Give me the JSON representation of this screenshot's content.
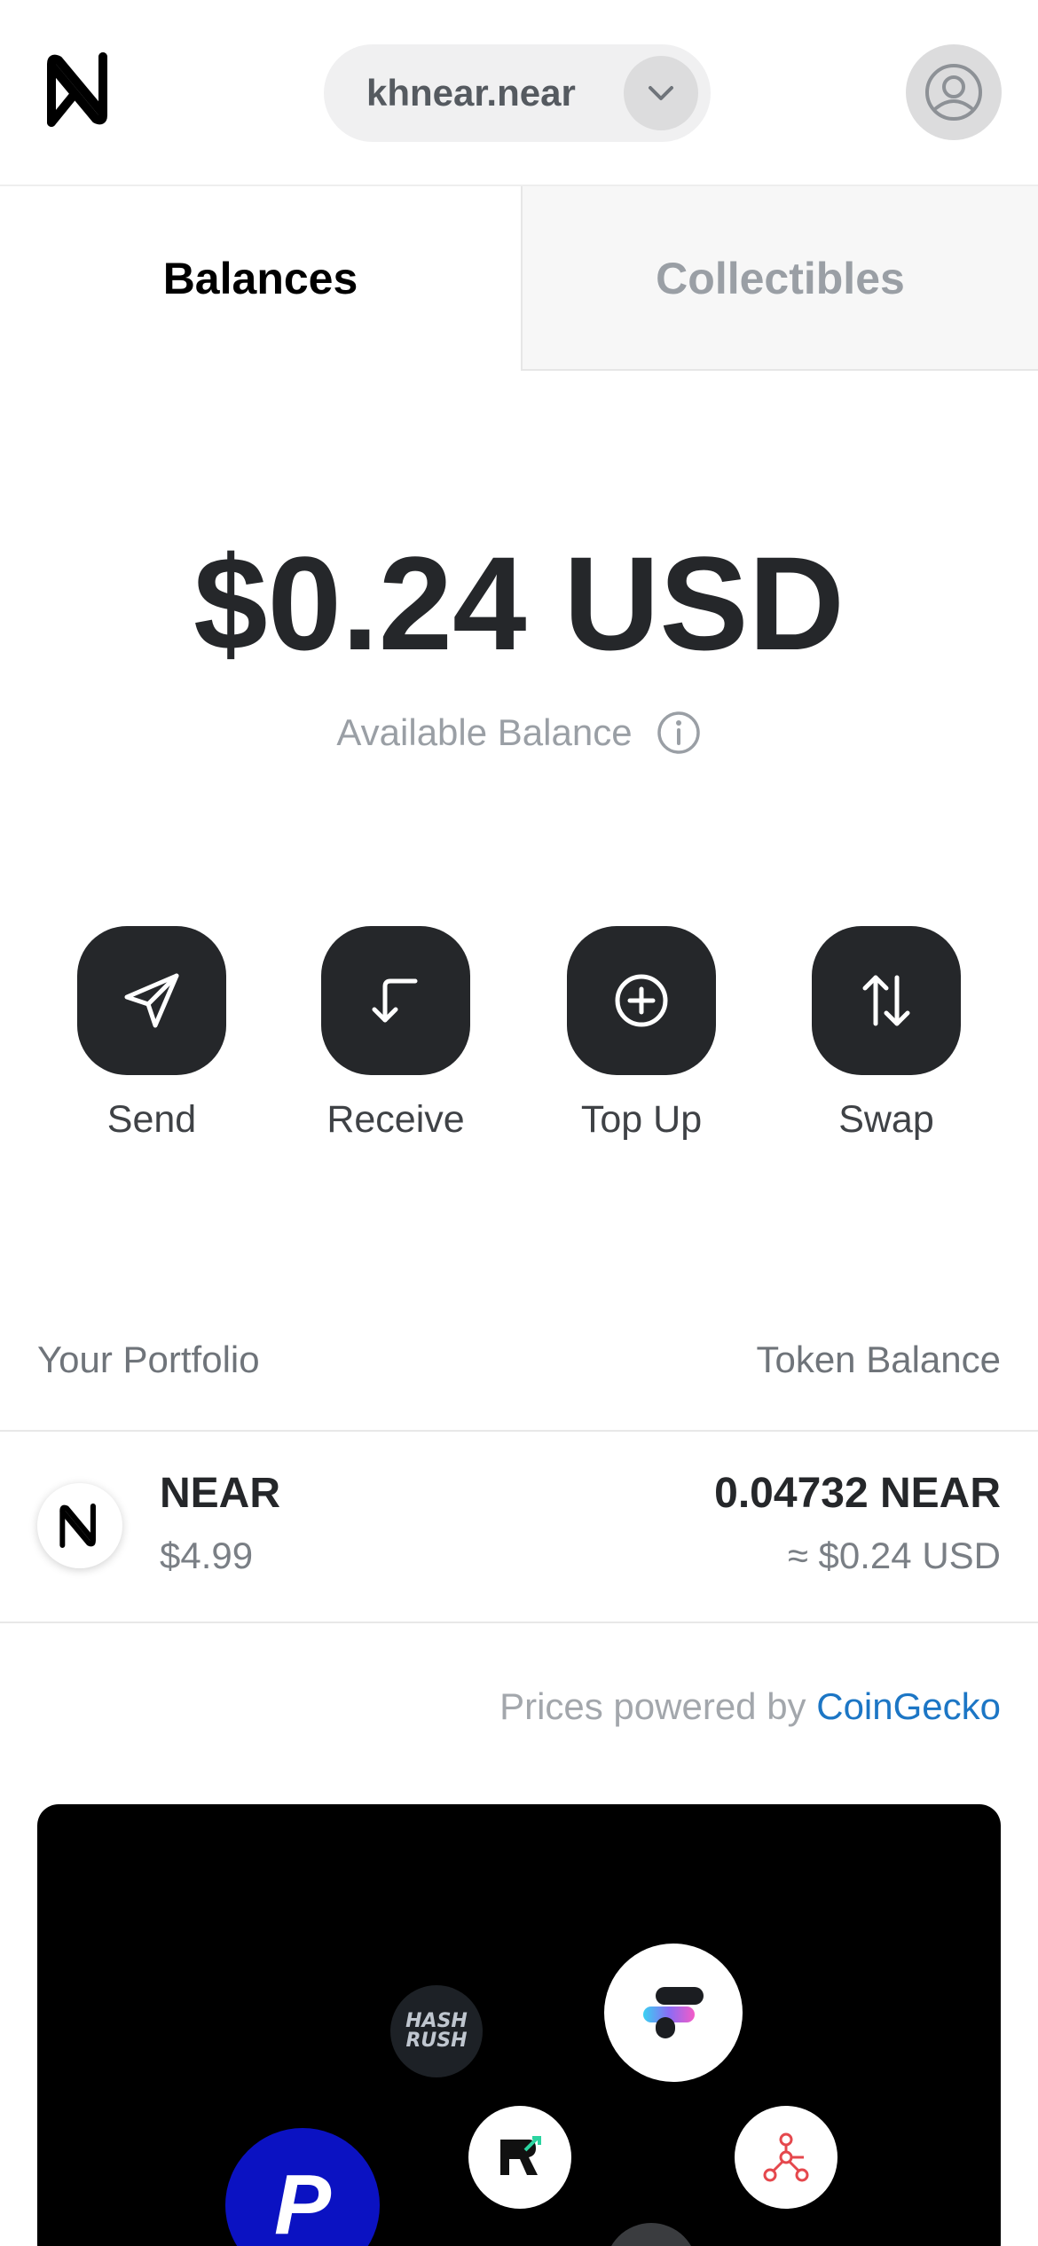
{
  "header": {
    "account_name": "khnear.near"
  },
  "tabs": [
    {
      "label": "Balances",
      "active": true
    },
    {
      "label": "Collectibles",
      "active": false
    }
  ],
  "balance": {
    "amount": "$0.24 USD",
    "label": "Available Balance"
  },
  "actions": [
    {
      "label": "Send",
      "icon": "send-icon"
    },
    {
      "label": "Receive",
      "icon": "receive-icon"
    },
    {
      "label": "Top Up",
      "icon": "plus-circle-icon"
    },
    {
      "label": "Swap",
      "icon": "swap-icon"
    }
  ],
  "portfolio": {
    "left_header": "Your Portfolio",
    "right_header": "Token Balance",
    "tokens": [
      {
        "name": "NEAR",
        "price": "$4.99",
        "amount": "0.04732 NEAR",
        "usd": "≈ $0.24 USD"
      }
    ]
  },
  "footer": {
    "prices_text": "Prices powered by",
    "prices_link": "CoinGecko"
  },
  "promo": {
    "bubbles": [
      "hash-rush-logo",
      "flow-logo",
      "r-logo",
      "tree-logo",
      "p-logo",
      "grey-logo"
    ],
    "hash_rush_text": "HASH RUSH",
    "p_letter": "P"
  },
  "colors": {
    "primary_dark": "#25272a",
    "link": "#1c76c5",
    "muted": "#9a9fa5",
    "promo_bg": "#000000"
  }
}
